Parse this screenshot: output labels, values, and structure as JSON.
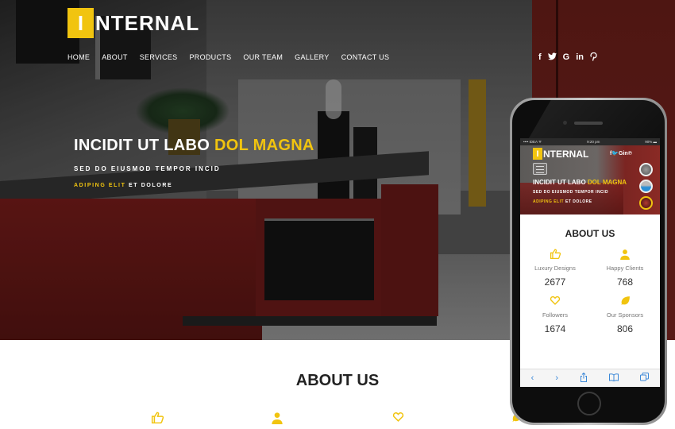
{
  "header": {
    "logo_mark": "I",
    "logo_word": "NTERNAL",
    "nav": [
      "HOME",
      "ABOUT",
      "SERVICES",
      "PRODUCTS",
      "OUR TEAM",
      "GALLERY",
      "CONTACT US"
    ],
    "social": [
      {
        "name": "facebook-icon",
        "glyph": "f"
      },
      {
        "name": "twitter-icon",
        "glyph": "🐦"
      },
      {
        "name": "google-icon",
        "glyph": "G"
      },
      {
        "name": "linkedin-icon",
        "glyph": "in"
      },
      {
        "name": "pinterest-icon",
        "glyph": "℗"
      }
    ]
  },
  "hero": {
    "title_main": "INCIDIT UT LABO ",
    "title_highlight": "DOL MAGNA",
    "subtitle": "SED DO EIUSMOD TEMPOR INCID",
    "tagline_highlight": "ADIPING ELIT",
    "tagline_rest": " ET DOLORE"
  },
  "about": {
    "title": "ABOUT US",
    "icons": [
      "thumbs-up-icon",
      "user-icon",
      "heart-icon",
      "leaf-icon"
    ]
  },
  "phone": {
    "status": {
      "carrier": "•••• IDEA ᯤ",
      "time": "9:20 pm",
      "battery": "90% ▬"
    },
    "logo_mark": "I",
    "logo_word": "NTERNAL",
    "social": "f🐦Gin℗",
    "title_main": "INCIDIT UT LABO ",
    "title_highlight": "DOL MAGNA",
    "subtitle": "SED DO EIUSMOD TEMPOR INCID",
    "tagline_highlight": "ADIPING ELIT",
    "tagline_rest": " ET DOLORE",
    "about_title": "ABOUT US",
    "stats": [
      {
        "icon": "👍",
        "label": "Luxury Designs",
        "value": "2677"
      },
      {
        "icon": "👤",
        "label": "Happy Clients",
        "value": "768"
      },
      {
        "icon": "♡",
        "label": "Followers",
        "value": "1674"
      },
      {
        "icon": "🍃",
        "label": "Our Sponsors",
        "value": "806"
      }
    ],
    "toolbar": [
      "‹",
      "›",
      "⇪",
      "📖",
      "⧉"
    ]
  },
  "colors": {
    "accent": "#f1c40f",
    "text_dark": "#222222",
    "link_blue": "#3b88d8"
  }
}
